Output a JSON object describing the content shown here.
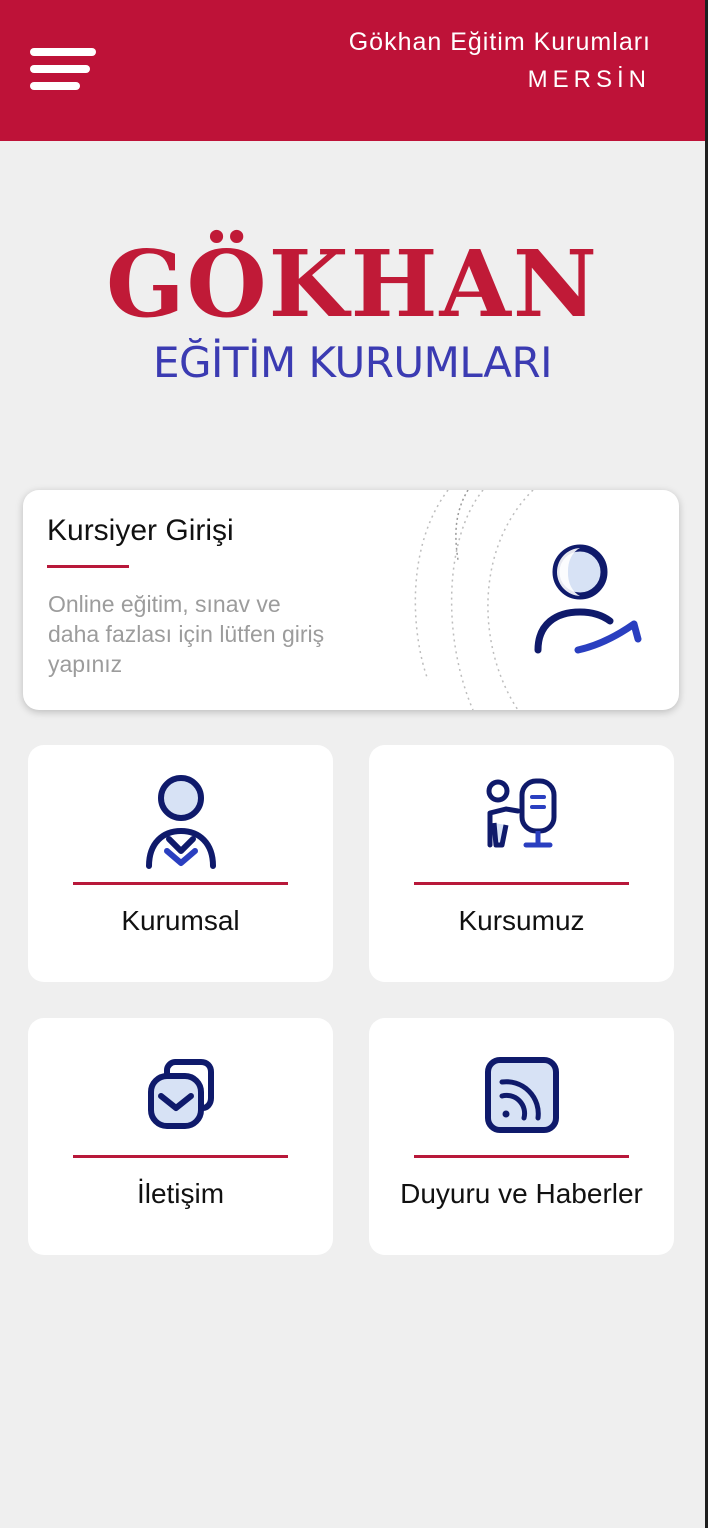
{
  "header": {
    "menu_icon": "hamburger-menu-icon",
    "institution": "Gökhan Eğitim Kurumları",
    "city": "MERSİN",
    "background": "#be1238"
  },
  "logo": {
    "title": "GÖKHAN",
    "subtitle": "EĞİTİM KURUMLARI",
    "title_color": "#c01a37",
    "subtitle_color": "#3b3bb2"
  },
  "login_card": {
    "title": "Kursiyer Girişi",
    "description": "Online eğitim, sınav ve daha fazlası için lütfen giriş yapınız",
    "icon": "user-login-icon"
  },
  "tiles": [
    {
      "label": "Kurumsal",
      "icon": "corporate-person-icon"
    },
    {
      "label": "Kursumuz",
      "icon": "teacher-board-icon"
    },
    {
      "label": "İletişim",
      "icon": "contact-mail-icon"
    },
    {
      "label": "Duyuru ve Haberler",
      "icon": "rss-news-icon"
    }
  ],
  "colors": {
    "accent": "#b8183a",
    "icon_navy": "#0f1a6b",
    "icon_blue": "#2a3fc0",
    "background": "#efefef"
  }
}
